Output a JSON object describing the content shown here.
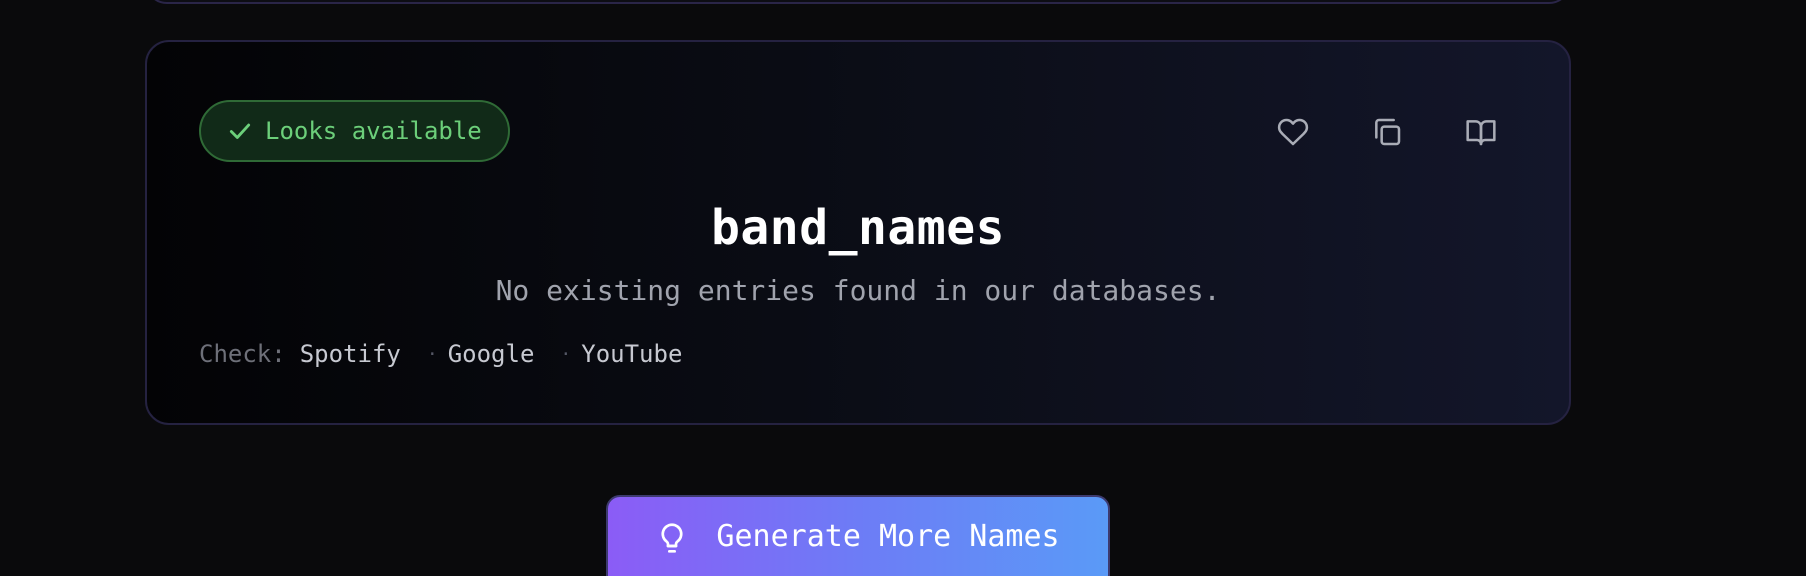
{
  "result_card": {
    "status_badge": "Looks available",
    "name": "band_names",
    "description": "No existing entries found in our databases.",
    "check_label": "Check:",
    "check_links": [
      "Spotify",
      "Google",
      "YouTube"
    ],
    "separator": "·",
    "actions": [
      "heart-icon",
      "copy-icon",
      "book-icon"
    ]
  },
  "generate_button": {
    "label": "Generate More Names",
    "icon": "lightbulb-icon"
  },
  "colors": {
    "available_green": "#6ccf7a",
    "button_gradient_start": "#8b5cf6",
    "button_gradient_end": "#5a9af7"
  }
}
